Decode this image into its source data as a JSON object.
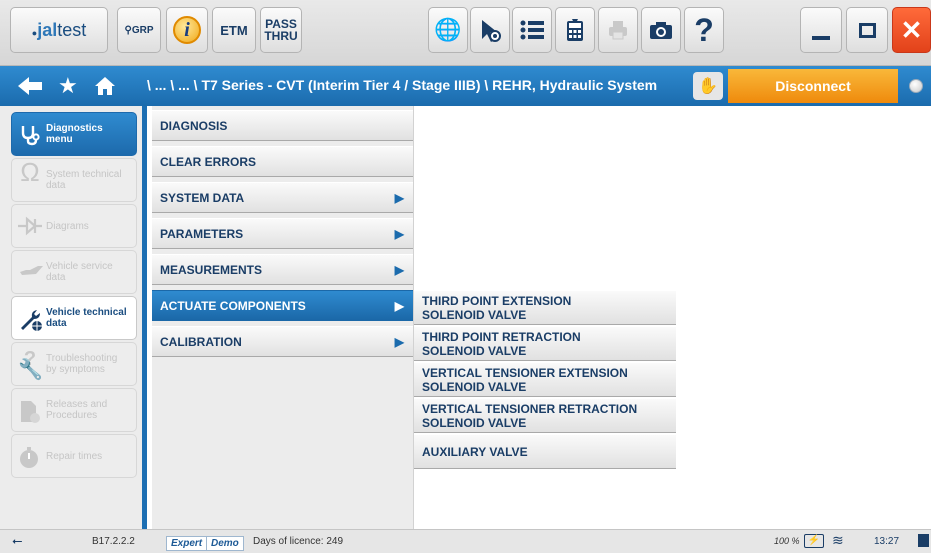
{
  "toolbar": {
    "logo_prefix": "●",
    "logo_bold": "jal",
    "logo_rest": "test",
    "grp_label": "⚲GRP",
    "info_label": "i",
    "etm_label": "ETM",
    "pass_thru_line1": "PASS",
    "pass_thru_line2": "THRU",
    "help_label": "?"
  },
  "navbar": {
    "path": "\\ ... \\ ... \\ T7 Series - CVT (Interim Tier 4 / Stage IIIB) \\ REHR, Hydraulic System",
    "disconnect_label": "Disconnect"
  },
  "sidebar": {
    "items": [
      {
        "label_line1": "Diagnostics",
        "label_line2": "menu"
      },
      {
        "label_line1": "System technical",
        "label_line2": "data"
      },
      {
        "label_line1": "Diagrams",
        "label_line2": ""
      },
      {
        "label_line1": "Vehicle service",
        "label_line2": "data"
      },
      {
        "label_line1": "Vehicle technical",
        "label_line2": "data"
      },
      {
        "label_line1": "Troubleshooting",
        "label_line2": "by symptoms"
      },
      {
        "label_line1": "Releases and",
        "label_line2": "Procedures"
      },
      {
        "label_line1": "Repair times",
        "label_line2": ""
      }
    ]
  },
  "menu": {
    "items": [
      "DIAGNOSIS",
      "CLEAR ERRORS",
      "SYSTEM DATA",
      "PARAMETERS",
      "MEASUREMENTS",
      "ACTUATE COMPONENTS",
      "CALIBRATION"
    ]
  },
  "submenu": {
    "items": [
      {
        "line1": "THIRD POINT EXTENSION",
        "line2": "SOLENOID VALVE"
      },
      {
        "line1": "THIRD POINT RETRACTION",
        "line2": "SOLENOID VALVE"
      },
      {
        "line1": "VERTICAL TENSIONER EXTENSION",
        "line2": "SOLENOID VALVE"
      },
      {
        "line1": "VERTICAL TENSIONER RETRACTION",
        "line2": "SOLENOID VALVE"
      },
      {
        "line1": "AUXILIARY VALVE",
        "line2": ""
      }
    ]
  },
  "status": {
    "version": "B17.2.2.2",
    "expert_badge": "Expert",
    "demo_badge": "Demo",
    "licence": "Days of licence: 249",
    "battery": "100 %",
    "time": "13:27"
  },
  "colors": {
    "accent": "#1d6fb3",
    "disconnect": "#f39a12",
    "close": "#e94a20"
  }
}
